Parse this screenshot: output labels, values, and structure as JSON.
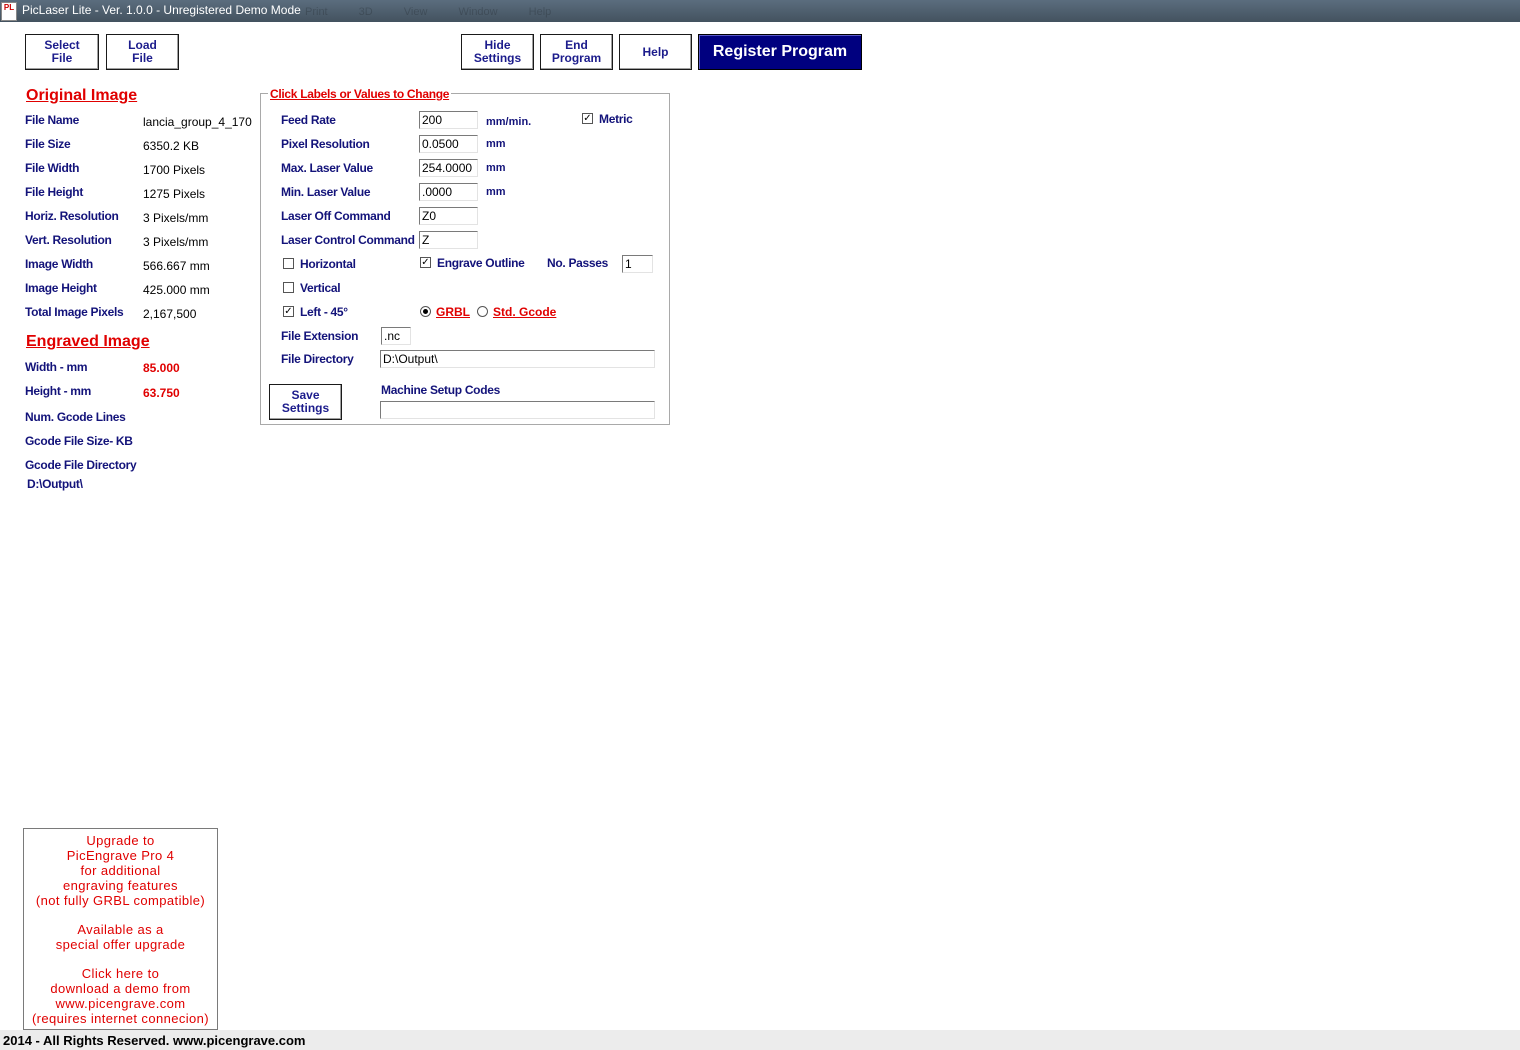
{
  "window": {
    "title": "PicLaser Lite - Ver. 1.0.0 - Unregistered Demo Mode",
    "icon_text": "PL",
    "ghost_menu": "Print 3D View Window Help"
  },
  "toolbar": {
    "select_file": "Select\nFile",
    "load_file": "Load\nFile",
    "hide_settings": "Hide\nSettings",
    "end_program": "End\nProgram",
    "help": "Help",
    "register": "Register Program"
  },
  "original_image": {
    "title": "Original Image",
    "rows": [
      {
        "label": "File Name",
        "value": "lancia_group_4_170"
      },
      {
        "label": "File Size",
        "value": "6350.2  KB"
      },
      {
        "label": "File Width",
        "value": "1700  Pixels"
      },
      {
        "label": "File Height",
        "value": "1275  Pixels"
      },
      {
        "label": "Horiz. Resolution",
        "value": "3 Pixels/mm"
      },
      {
        "label": "Vert. Resolution",
        "value": "3 Pixels/mm"
      },
      {
        "label": "Image Width",
        "value": "566.667 mm"
      },
      {
        "label": "Image Height",
        "value": "425.000 mm"
      },
      {
        "label": "Total Image Pixels",
        "value": "2,167,500"
      }
    ]
  },
  "engraved_image": {
    "title": "Engraved Image",
    "width_label": "Width - mm",
    "width_value": "85.000",
    "height_label": "Height - mm",
    "height_value": "63.750",
    "gcode_lines_label": "Num. Gcode Lines",
    "gcode_size_label": "Gcode File Size- KB",
    "gcode_dir_label": "Gcode File Directory",
    "gcode_dir_value": "D:\\Output\\"
  },
  "settings": {
    "legend": "Click Labels or Values to Change",
    "feed_rate_label": "Feed Rate",
    "feed_rate_value": "200",
    "feed_rate_unit": "mm/min.",
    "pixel_res_label": "Pixel Resolution",
    "pixel_res_value": "0.0500",
    "pixel_res_unit": "mm",
    "max_laser_label": "Max. Laser Value",
    "max_laser_value": "254.0000",
    "max_laser_unit": "mm",
    "min_laser_label": "Min. Laser Value",
    "min_laser_value": ".0000",
    "min_laser_unit": "mm",
    "laser_off_label": "Laser Off Command",
    "laser_off_value": "Z0",
    "laser_control_label": "Laser Control Command",
    "laser_control_value": "Z",
    "metric_label": "Metric",
    "metric_checked": true,
    "horizontal_label": "Horizontal",
    "horizontal_checked": false,
    "engrave_outline_label": "Engrave Outline",
    "engrave_outline_checked": true,
    "passes_label": "No. Passes",
    "passes_value": "1",
    "vertical_label": "Vertical",
    "vertical_checked": false,
    "left45_label": "Left - 45°",
    "left45_checked": true,
    "grbl_label": "GRBL",
    "grbl_selected": true,
    "std_gcode_label": "Std. Gcode",
    "std_gcode_selected": false,
    "file_ext_label": "File Extension",
    "file_ext_value": ".nc",
    "file_dir_label": "File Directory",
    "file_dir_value": "D:\\Output\\",
    "save_settings": "Save\nSettings",
    "machine_setup_label": "Machine Setup Codes",
    "machine_setup_value": ""
  },
  "promo": {
    "para1": "Upgrade  to\nPicEngrave Pro 4\nfor  additional\nengraving  features\n(not fully GRBL  compatible)",
    "para2": "Available  as  a\nspecial  offer  upgrade",
    "para3": "Click  here  to\ndownload  a  demo  from\nwww.picengrave.com\n(requires  internet  connecion)"
  },
  "footer": {
    "text": "2014 - All Rights Reserved.  www.picengrave.com"
  },
  "colors": {
    "label_blue": "#13137a",
    "accent_red": "#e00000",
    "register_bg": "#00007f",
    "titlebar": "#4b5a68"
  }
}
